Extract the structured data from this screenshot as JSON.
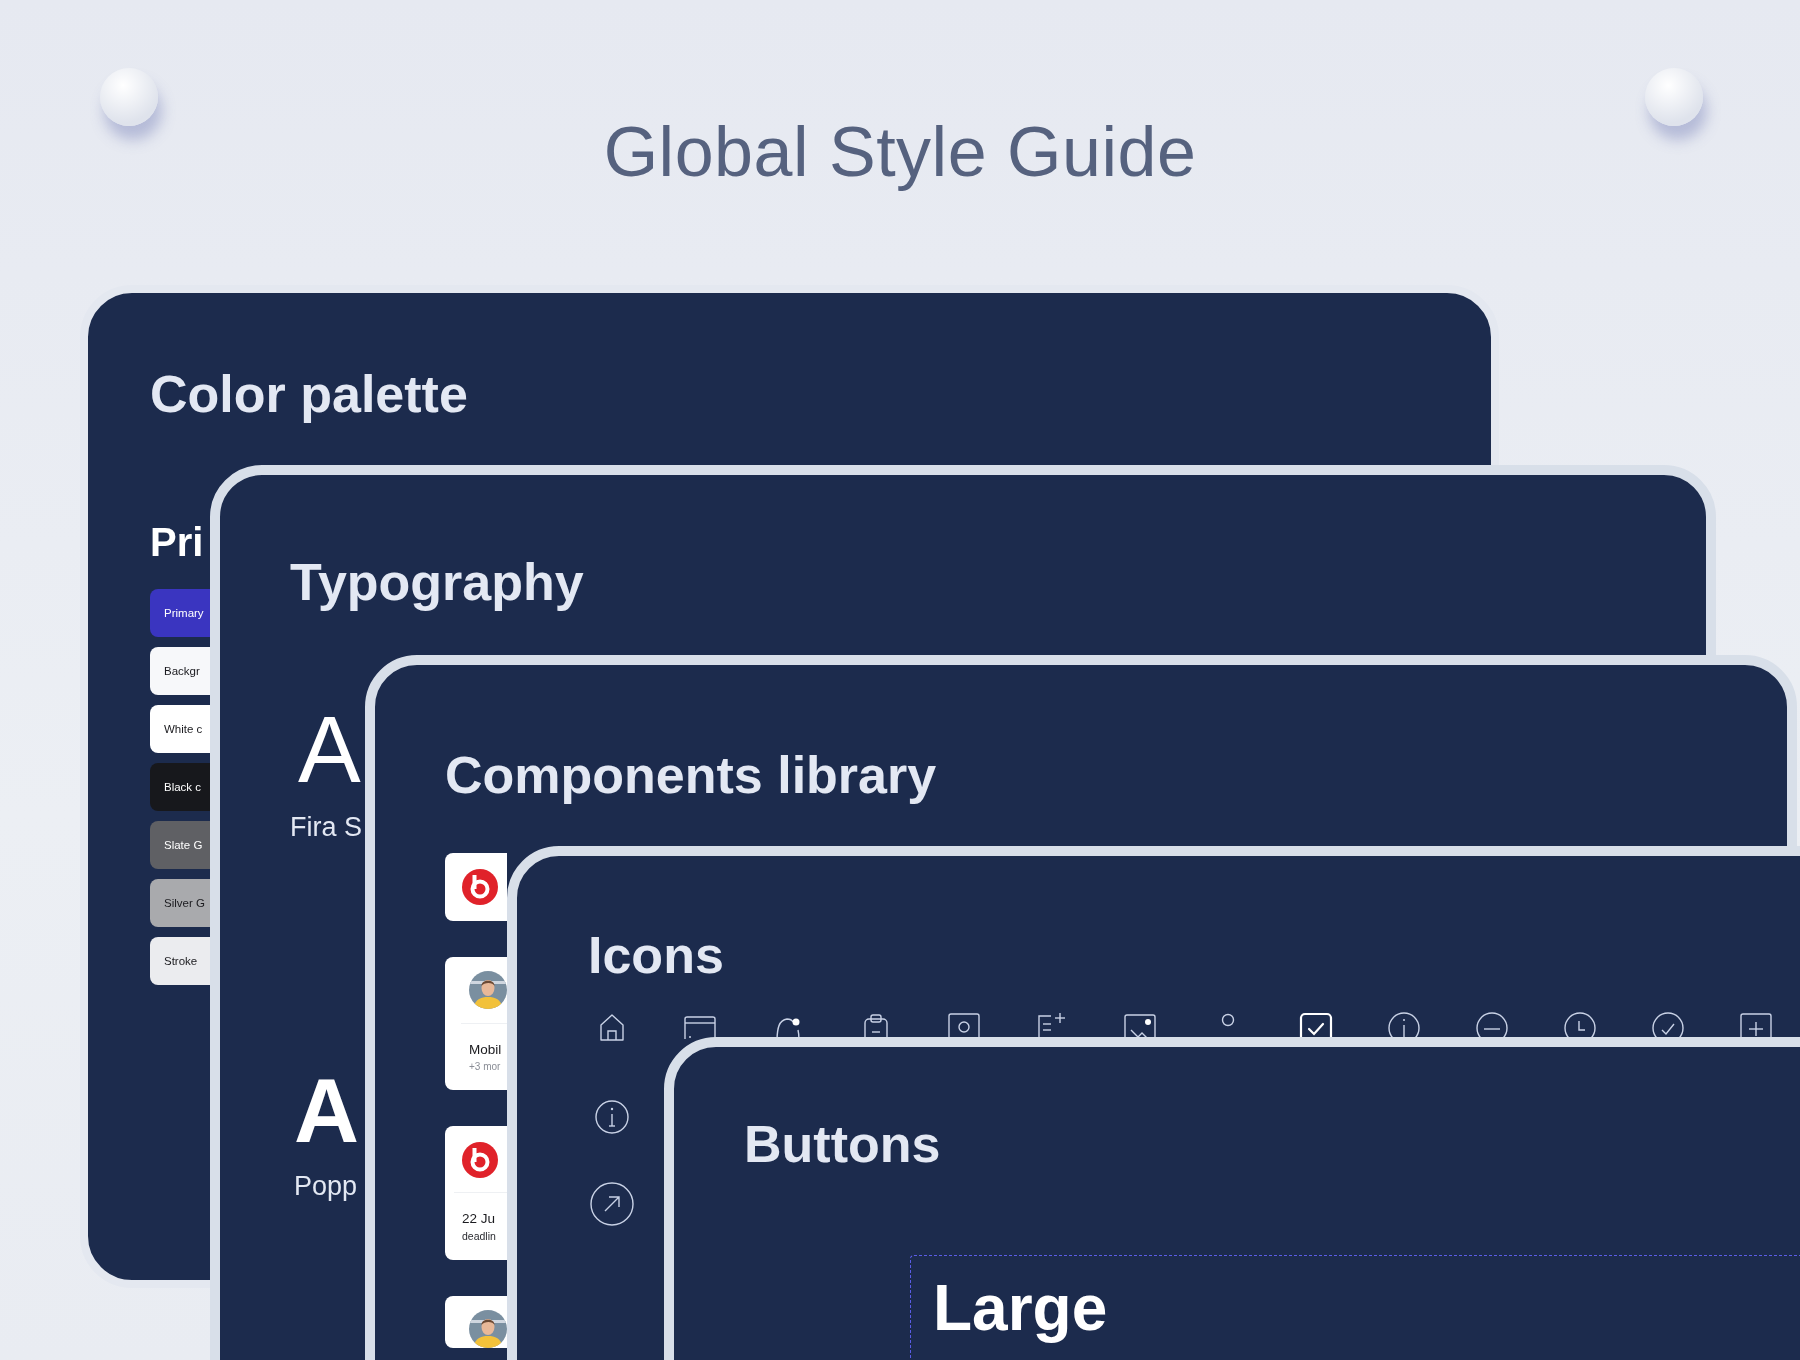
{
  "page": {
    "title": "Global Style Guide"
  },
  "color_palette": {
    "title": "Color palette",
    "section": "Pri",
    "swatches": [
      {
        "label": "Primary",
        "color": "#3a35c0"
      },
      {
        "label": "Backgr",
        "color": "#f7f8fa"
      },
      {
        "label": "White c",
        "color": "#ffffff"
      },
      {
        "label": "Black c",
        "color": "#17181c"
      },
      {
        "label": "Slate G",
        "color": "#5f6064"
      },
      {
        "label": "Silver G",
        "color": "#a9aaad"
      },
      {
        "label": "Stroke",
        "color": "#ebecef"
      }
    ]
  },
  "typography": {
    "title": "Typography",
    "samples": [
      {
        "kind": "light",
        "glyph": "A",
        "name": "Fira S"
      },
      {
        "kind": "bold",
        "glyph": "A",
        "name": "Popp"
      }
    ]
  },
  "components": {
    "title": "Components library",
    "cards": [
      {
        "kind": "logo"
      },
      {
        "kind": "avatar",
        "title": "Mobil",
        "subtitle": "+3 mor"
      },
      {
        "kind": "logo",
        "title": "22 Ju",
        "subtitle": "deadlin"
      },
      {
        "kind": "avatar"
      }
    ]
  },
  "icons": {
    "title": "Icons"
  },
  "buttons": {
    "title": "Buttons",
    "size_label": "Large"
  }
}
